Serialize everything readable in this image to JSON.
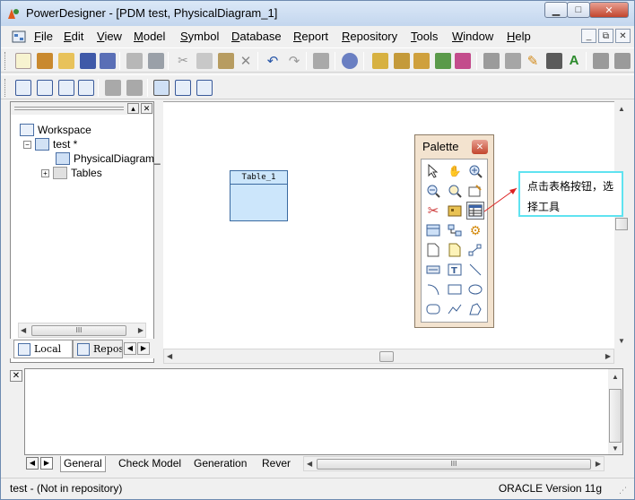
{
  "window": {
    "title": "PowerDesigner - [PDM test, PhysicalDiagram_1]"
  },
  "menu": [
    "File",
    "Edit",
    "View",
    "Model",
    "Symbol",
    "Database",
    "Report",
    "Repository",
    "Tools",
    "Window",
    "Help"
  ],
  "browser": {
    "tree": {
      "workspace": "Workspace",
      "model": "test *",
      "diagram": "PhysicalDiagram_",
      "tables": "Tables"
    },
    "tabs": {
      "local": "Local",
      "repository": "Repos"
    }
  },
  "diagram": {
    "table_name": "Table_1"
  },
  "palette": {
    "title": "Palette"
  },
  "callout": {
    "text": "点击表格按钮，选择工具"
  },
  "output": {
    "tabs": [
      "General",
      "Check Model",
      "Generation",
      "Rever"
    ]
  },
  "status": {
    "left": "test - (Not in repository)",
    "right": "ORACLE Version 11g"
  }
}
